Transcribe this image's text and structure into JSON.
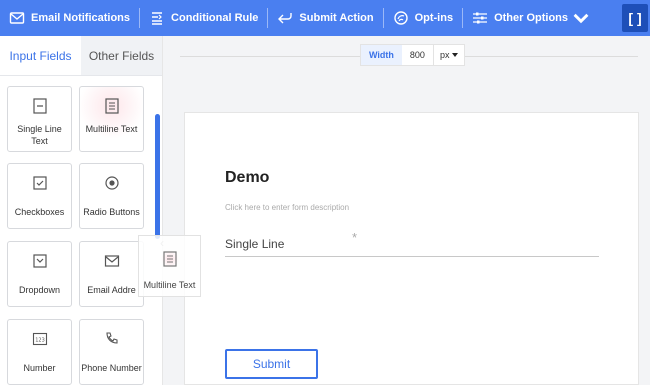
{
  "toolbar": {
    "items": [
      {
        "label": "Email Notifications",
        "icon": "mail-icon"
      },
      {
        "label": "Conditional Rule",
        "icon": "conditional-rule-icon"
      },
      {
        "label": "Submit Action",
        "icon": "submit-action-icon"
      },
      {
        "label": "Opt-ins",
        "icon": "opt-ins-icon"
      },
      {
        "label": "Other Options",
        "icon": "sliders-icon"
      }
    ],
    "fullscreen_label": "[ ]",
    "accent": "#4a7ff0"
  },
  "left_panel": {
    "tabs": [
      {
        "label": "Input Fields",
        "active": true
      },
      {
        "label": "Other Fields",
        "active": false
      }
    ],
    "fields": [
      {
        "label": "Single Line Text",
        "icon": "single-line-icon"
      },
      {
        "label": "Multiline Text",
        "icon": "multiline-icon"
      },
      {
        "label": "Checkboxes",
        "icon": "checkbox-icon"
      },
      {
        "label": "Radio Buttons",
        "icon": "radio-icon"
      },
      {
        "label": "Dropdown",
        "icon": "dropdown-icon"
      },
      {
        "label": "Email Addre",
        "icon": "mail-icon"
      },
      {
        "label": "Number",
        "icon": "number-icon"
      },
      {
        "label": "Phone Number",
        "icon": "phone-icon"
      }
    ]
  },
  "drag_ghost": {
    "label": "Multiline Text",
    "icon": "multiline-icon"
  },
  "canvas": {
    "width_label": "Width",
    "width_value": "800",
    "width_unit": "px"
  },
  "form": {
    "title": "Demo",
    "description": "Click here to enter form description",
    "field_label": "Single Line",
    "required_mark": "*",
    "submit_label": "Submit"
  }
}
